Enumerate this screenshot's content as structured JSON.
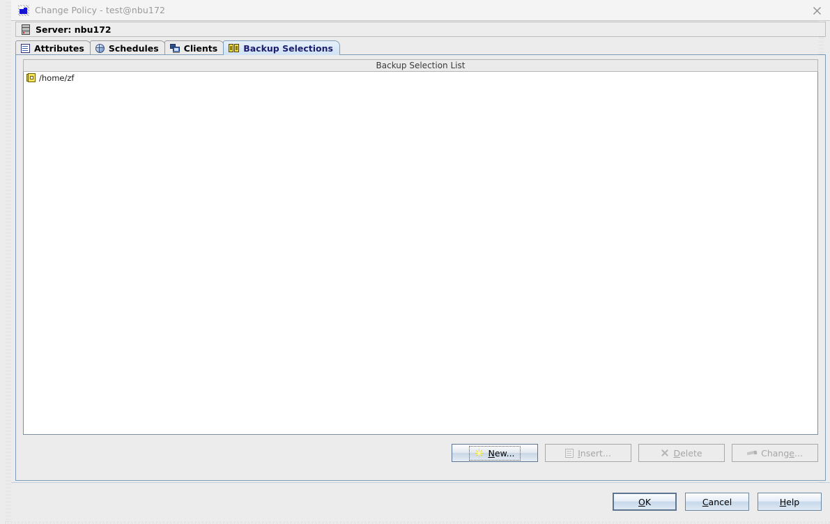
{
  "window": {
    "title": "Change Policy - test@nbu172",
    "title_icon": "app-window-icon",
    "close_icon": "close-icon"
  },
  "server_bar": {
    "icon": "server-icon",
    "label": "Server: nbu172"
  },
  "tabs": [
    {
      "label": "Attributes",
      "icon": "attributes-icon",
      "selected": false
    },
    {
      "label": "Schedules",
      "icon": "clock-icon",
      "selected": false
    },
    {
      "label": "Clients",
      "icon": "computers-icon",
      "selected": false
    },
    {
      "label": "Backup Selections",
      "icon": "backup-selections-icon",
      "selected": true
    }
  ],
  "list": {
    "header": "Backup Selection List",
    "rows": [
      {
        "icon": "file-folder-icon",
        "path": "/home/zf"
      }
    ]
  },
  "action_buttons": [
    {
      "label": "New...",
      "mnemonic": "N",
      "icon": "starburst-icon",
      "enabled": true,
      "focused": true
    },
    {
      "label": "Insert...",
      "mnemonic": "I",
      "icon": "document-icon",
      "enabled": false,
      "focused": false
    },
    {
      "label": "Delete",
      "mnemonic": "D",
      "icon": "x-icon",
      "enabled": false,
      "focused": false
    },
    {
      "label": "Change...",
      "mnemonic": "e",
      "icon": "pencil-icon",
      "enabled": false,
      "focused": false
    }
  ],
  "dialog_buttons": [
    {
      "label": "OK",
      "mnemonic": "O",
      "default": true
    },
    {
      "label": "Cancel",
      "mnemonic": "C",
      "default": false
    },
    {
      "label": "Help",
      "mnemonic": "H",
      "default": false
    }
  ],
  "colors": {
    "selected_tab_text": "#1d1d6e",
    "selected_tab_bg": "#cfe2f5",
    "panel_border": "#7f9db9",
    "title_text": "#9a9a9a",
    "disabled_text": "#a6a6a6",
    "list_bg": "#ffffff",
    "window_bg": "#ececec",
    "accent_yellow": "#f2e14a"
  }
}
